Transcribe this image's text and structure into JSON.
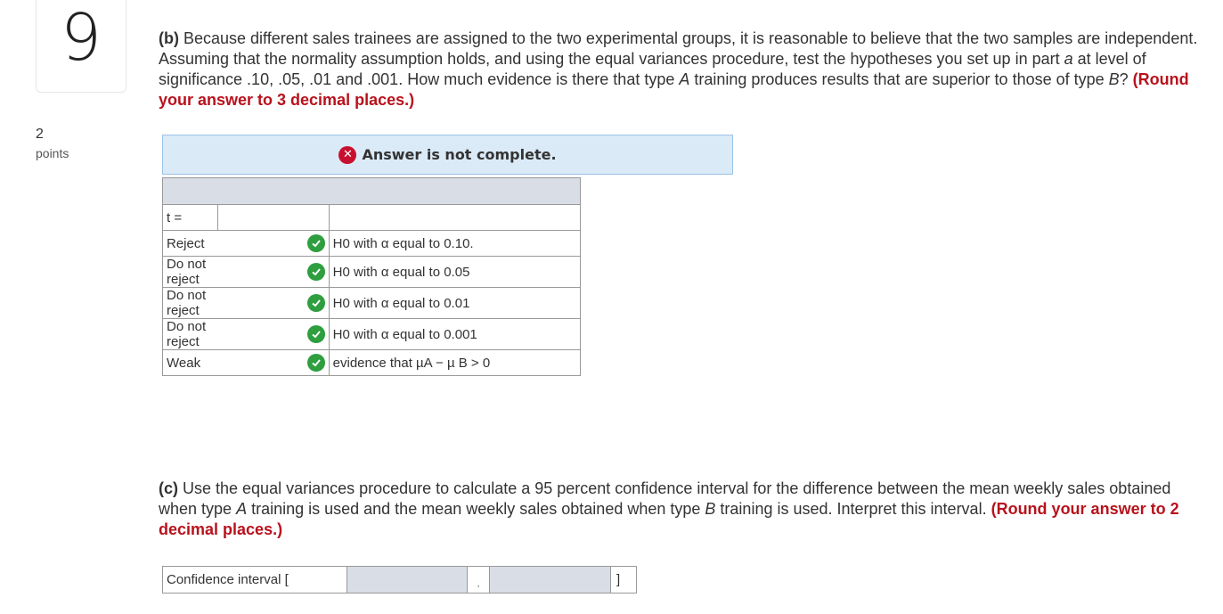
{
  "question": {
    "number": "9",
    "points_value": "2",
    "points_label": "points"
  },
  "part_b": {
    "label": "(b)",
    "text_1": " Because different sales trainees are assigned to the two experimental groups, it is reasonable to believe that the two samples are independent. Assuming that the normality assumption holds, and using the equal variances procedure, test the hypotheses you set up in part ",
    "italic_a": "a",
    "text_2": " at level of significance .10, .05, .01 and .001. How much evidence is there that type ",
    "italic_A": "A",
    "text_3": " training produces results that are superior to those of type ",
    "italic_B": "B",
    "text_4": "? ",
    "round_note": "(Round your answer to 3 decimal places.)"
  },
  "banner": {
    "icon": "x-circle-icon",
    "text": "Answer is not complete."
  },
  "answer_table": {
    "t_label": "t =",
    "t_value": "",
    "rows": [
      {
        "answer": "Reject",
        "status": "correct",
        "statement": "H0 with α equal to 0.10."
      },
      {
        "answer": "Do not reject",
        "status": "correct",
        "statement": "H0 with α equal to 0.05"
      },
      {
        "answer": "Do not reject",
        "status": "correct",
        "statement": "H0 with α equal to 0.01"
      },
      {
        "answer": "Do not reject",
        "status": "correct",
        "statement": "H0 with α equal to 0.001"
      },
      {
        "answer": "Weak",
        "status": "correct",
        "statement": "evidence that µA − µ B > 0"
      }
    ]
  },
  "part_c": {
    "label": "(c)",
    "text_1": " Use the equal variances procedure to calculate a 95 percent confidence interval for the difference between the mean weekly sales obtained when type ",
    "italic_A": "A",
    "text_2": " training is used and the mean weekly sales obtained when type ",
    "italic_B": "B",
    "text_3": " training is used. Interpret this interval. ",
    "round_note": "(Round your answer to 2 decimal places.)"
  },
  "confidence_interval": {
    "label": "Confidence interval [",
    "lower_value": "",
    "separator": ",",
    "upper_value": "",
    "close": "]"
  },
  "colors": {
    "accent_red": "#b8121c",
    "banner_bg": "#dbeaf7",
    "check_green": "#2e9e3f",
    "input_gray": "#d9dde6"
  }
}
